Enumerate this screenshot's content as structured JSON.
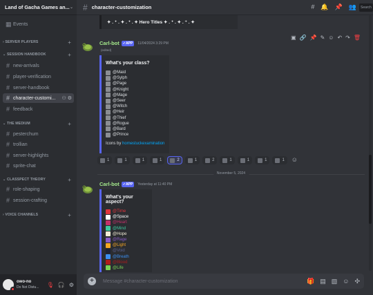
{
  "server": {
    "name": "Land of Gacha Games an..."
  },
  "sidebar": {
    "events": "Events",
    "categories": [
      {
        "label": "SERVER PLAYERS"
      },
      {
        "label": "SESSION HANDBOOK"
      },
      {
        "label": "THE MEDIUM"
      },
      {
        "label": "CLASSPECT THEORY"
      },
      {
        "label": "VOICE CHANNELS"
      }
    ],
    "channels": [
      {
        "label": "new-arrivals"
      },
      {
        "label": "player-verification"
      },
      {
        "label": "server-handbook"
      },
      {
        "label": "character-customi..."
      },
      {
        "label": "feedback"
      },
      {
        "label": "pesterchum"
      },
      {
        "label": "trollian"
      },
      {
        "label": "server-highlights"
      },
      {
        "label": "sprite-chat"
      },
      {
        "label": "role-shaping"
      },
      {
        "label": "session-crafting"
      }
    ]
  },
  "user": {
    "name": "owo-no",
    "status": "Do Not Distu..."
  },
  "topbar": {
    "channel": "character-customization",
    "search": "Search"
  },
  "banner": {
    "text": "✦ . ⁺ . ✦ . ⁺ . ✦ Hero Titles ✦ . ⁺ . ✦ . ⁺ . ✦"
  },
  "messages": [
    {
      "author": "Carl-bot",
      "badge": "✓APP",
      "timestamp": "11/04/2024 3:29 PM",
      "edited": "(edited)",
      "embed": {
        "title": "What's your class?",
        "roles": [
          "@Maid",
          "@Sylph",
          "@Page",
          "@Knight",
          "@Mage",
          "@Seer",
          "@Witch",
          "@Heir",
          "@Thief",
          "@Rogue",
          "@Bard",
          "@Prince"
        ],
        "footer_prefix": "Icons by ",
        "footer_link": "homestuckexamination"
      },
      "reactions": [
        {
          "count": "1",
          "me": false
        },
        {
          "count": "1",
          "me": false
        },
        {
          "count": "1",
          "me": false
        },
        {
          "count": "1",
          "me": false
        },
        {
          "count": "2",
          "me": true
        },
        {
          "count": "1",
          "me": false
        },
        {
          "count": "2",
          "me": false
        },
        {
          "count": "1",
          "me": false
        },
        {
          "count": "1",
          "me": false
        },
        {
          "count": "1",
          "me": false
        },
        {
          "count": "1",
          "me": false
        }
      ]
    },
    {
      "author": "Carl-bot",
      "badge": "✓APP",
      "timestamp": "Yesterday at 11:40 PM",
      "embed": {
        "title": "What's your aspect?",
        "roles": [
          {
            "label": "@Time",
            "color": "#e0353d"
          },
          {
            "label": "@Space",
            "color": "#ffffff"
          },
          {
            "label": "@Heart",
            "color": "#c4316a"
          },
          {
            "label": "@Mind",
            "color": "#3ec9a0"
          },
          {
            "label": "@Hope",
            "color": "#f2ecd6"
          },
          {
            "label": "@Rage",
            "color": "#8a5cc9"
          },
          {
            "label": "@Light",
            "color": "#f5a623"
          },
          {
            "label": "@Void",
            "color": "#1d2236"
          },
          {
            "label": "@Breath",
            "color": "#3b8ff0"
          },
          {
            "label": "@Blood",
            "color": "#b01c1c"
          },
          {
            "label": "@Life",
            "color": "#7bd455"
          }
        ]
      }
    }
  ],
  "divider": "November 5, 2024",
  "composer": {
    "placeholder": "Message #character-customization"
  },
  "colors": {
    "accent": "#5865f2",
    "bot_name": "#a5ea8c",
    "link": "#00a8fc",
    "danger": "#f23f43"
  }
}
